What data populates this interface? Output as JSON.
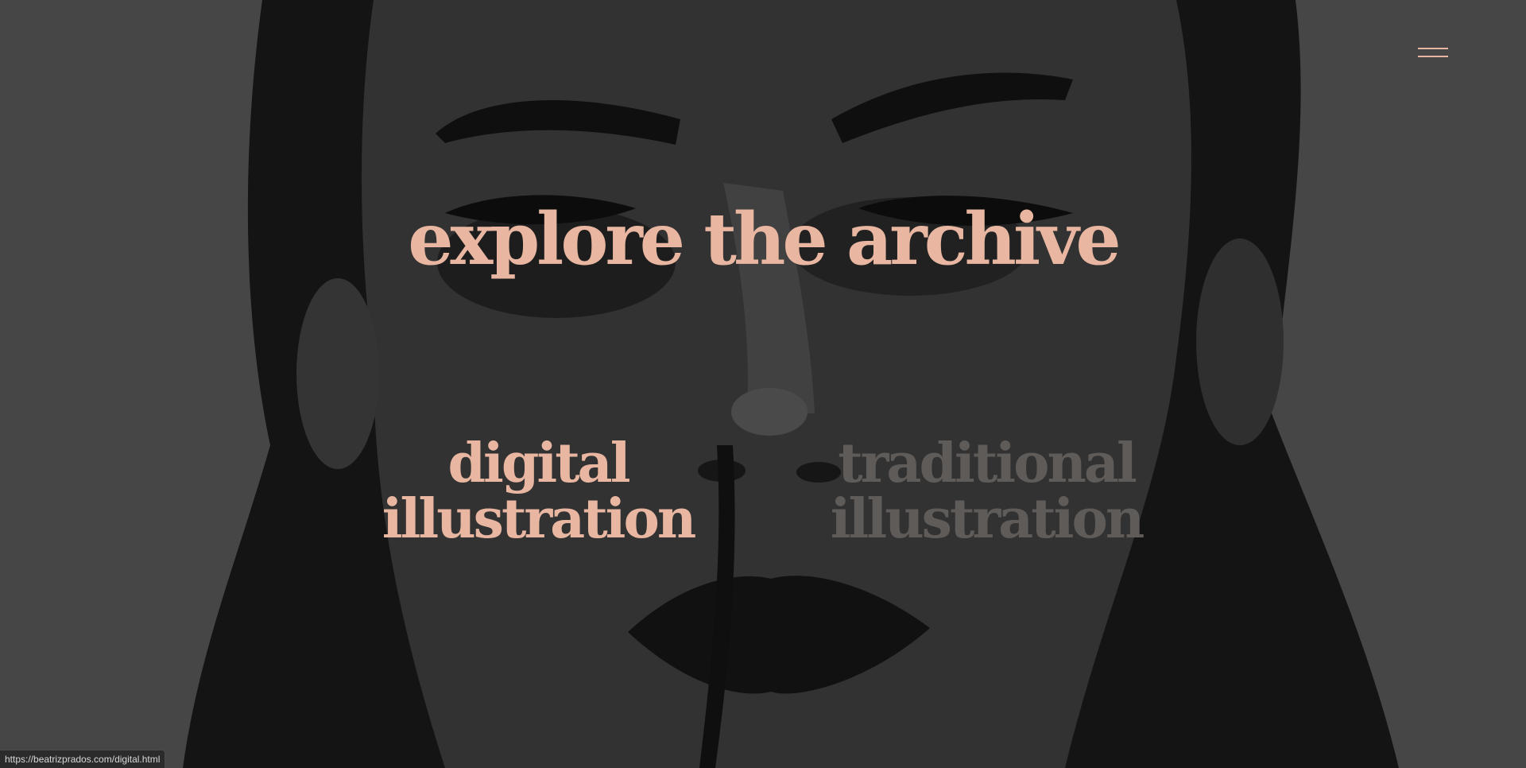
{
  "header": {
    "menu_icon": "hamburger-icon"
  },
  "hero": {
    "title": "explore the archive"
  },
  "categories": [
    {
      "line1": "digital",
      "line2": "illustration",
      "state": "hovered"
    },
    {
      "line1": "traditional",
      "line2": "illustration",
      "state": "dimmed"
    }
  ],
  "status_bar": {
    "url": "https://beatrizprados.com/digital.html"
  },
  "colors": {
    "accent": "#e9b7a1",
    "background": "#505050",
    "dimmed_text": "#5f5b59",
    "artwork_dark": "#161616"
  }
}
